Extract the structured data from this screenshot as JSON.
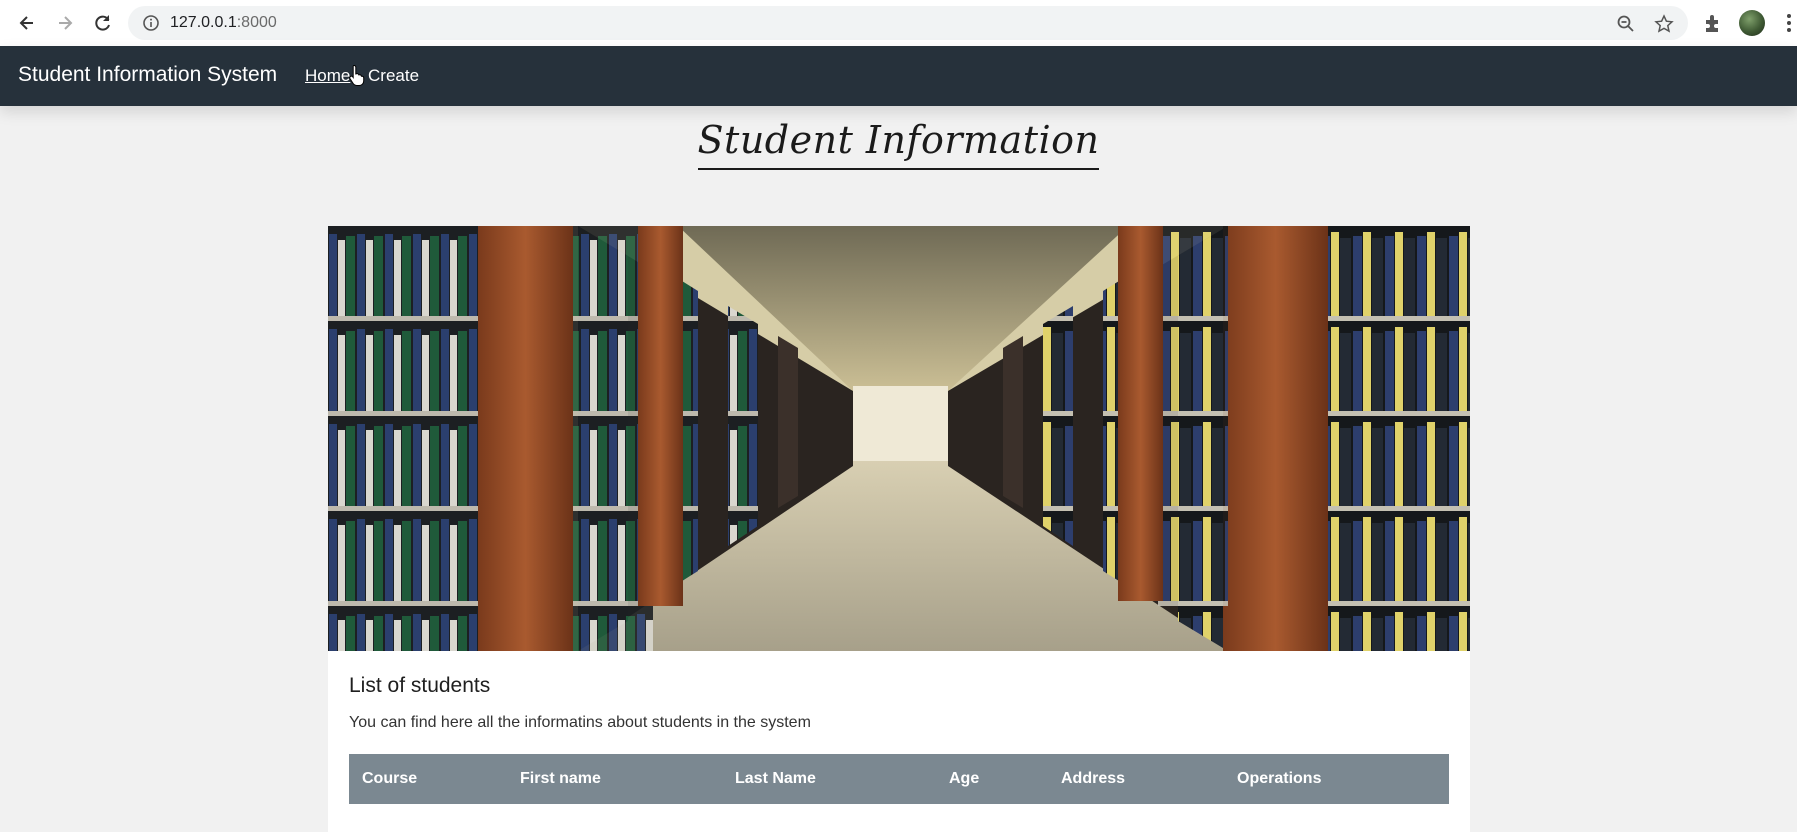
{
  "browser": {
    "url_host": "127.0.0.1",
    "url_port": ":8000",
    "icons": [
      "back-arrow-icon",
      "forward-arrow-icon",
      "reload-icon",
      "info-icon",
      "zoom-icon",
      "star-icon",
      "extensions-icon",
      "profile-avatar",
      "menu-dots-icon"
    ]
  },
  "navbar": {
    "brand": "Student Information System",
    "links": [
      {
        "label": "Home",
        "active": true
      },
      {
        "label": "Create",
        "active": false
      }
    ],
    "background": "#26313b"
  },
  "page": {
    "heading": "Student Information"
  },
  "card": {
    "hero_image": "library-bookshelves-aisle",
    "title": "List of students",
    "text": "You can find here all the informatins about students in the system",
    "table": {
      "header_color": "#7b8891",
      "columns": [
        "Course",
        "First name",
        "Last Name",
        "Age",
        "Address",
        "Operations"
      ]
    }
  }
}
